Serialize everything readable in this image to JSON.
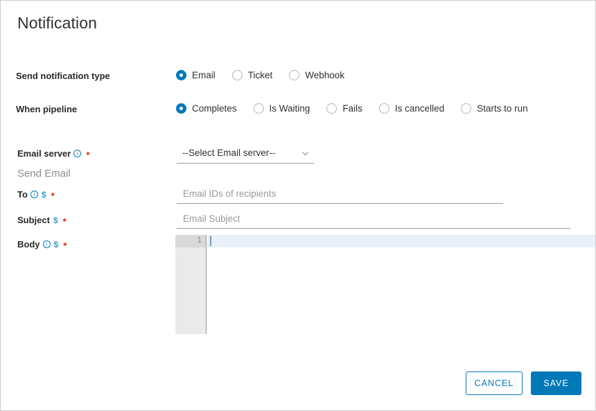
{
  "window": {
    "title": "Notification"
  },
  "form": {
    "notification_type": {
      "label": "Send notification type",
      "options": [
        {
          "label": "Email",
          "checked": true
        },
        {
          "label": "Ticket",
          "checked": false
        },
        {
          "label": "Webhook",
          "checked": false
        }
      ]
    },
    "when_pipeline": {
      "label": "When pipeline",
      "options": [
        {
          "label": "Completes",
          "checked": true
        },
        {
          "label": "Is Waiting",
          "checked": false
        },
        {
          "label": "Fails",
          "checked": false
        },
        {
          "label": "Is cancelled",
          "checked": false
        },
        {
          "label": "Starts to run",
          "checked": false
        }
      ]
    },
    "email_server": {
      "label": "Email server",
      "info_icon": "info-circle-icon",
      "required_marker": "*",
      "selected_value": "--Select Email server--",
      "chevron_icon": "chevron-down-icon"
    },
    "send_email_section": {
      "title": "Send Email"
    },
    "to": {
      "label": "To",
      "info_icon": "info-circle-icon",
      "variable_icon": "$",
      "required_marker": "*",
      "placeholder": "Email IDs of recipients",
      "value": ""
    },
    "subject": {
      "label": "Subject",
      "variable_icon": "$",
      "required_marker": "*",
      "placeholder": "Email Subject",
      "value": ""
    },
    "body": {
      "label": "Body",
      "info_icon": "info-circle-icon",
      "variable_icon": "$",
      "required_marker": "*",
      "line_number": "1",
      "value": ""
    }
  },
  "footer": {
    "cancel_label": "CANCEL",
    "save_label": "SAVE"
  },
  "colors": {
    "accent": "#0079b8",
    "required": "#e02200",
    "variable": "#3a9cd4",
    "text": "#313131",
    "muted": "#8c8c8c",
    "active_line": "#e8f0f9",
    "gutter": "#eaeaea"
  }
}
